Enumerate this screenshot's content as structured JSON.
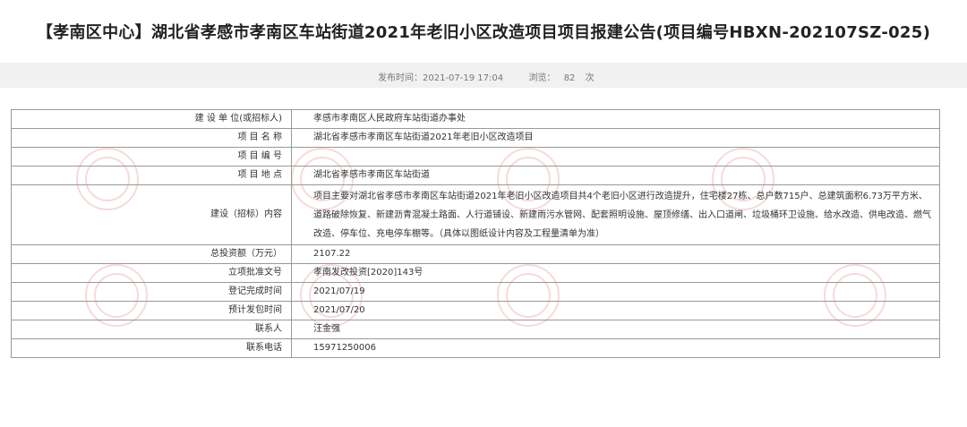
{
  "header": {
    "title": "【孝南区中心】湖北省孝感市孝南区车站街道2021年老旧小区改造项目项目报建公告(项目编号HBXN-202107SZ-025)",
    "publish_label": "发布时间：",
    "publish_time": "2021-07-19 17:04",
    "views_label": "浏览：",
    "views_count": "82",
    "views_unit": "次"
  },
  "rows": [
    {
      "label": "建 设 单 位(或招标人)",
      "value": "孝感市孝南区人民政府车站街道办事处"
    },
    {
      "label": "项 目 名 称",
      "value": "湖北省孝感市孝南区车站街道2021年老旧小区改造项目"
    },
    {
      "label": "项 目 编 号",
      "value": ""
    },
    {
      "label": "项 目 地 点",
      "value": "湖北省孝感市孝南区车站街道"
    },
    {
      "label": "建设（招标）内容",
      "value": "项目主要对湖北省孝感市孝南区车站街道2021年老旧小区改造项目共4个老旧小区进行改造提升，住宅楼27栋、总户数715户、总建筑面积6.73万平方米、道路破除恢复、新建沥青混凝土路面、人行道铺设、新建雨污水管网、配套照明设施、屋顶修缮、出入口道闸、垃圾桶环卫设施、给水改造、供电改造、燃气改造、停车位、充电停车棚等。（具体以图纸设计内容及工程量清单为准）"
    },
    {
      "label": "总投资额（万元）",
      "value": "2107.22"
    },
    {
      "label": "立项批准文号",
      "value": "孝南发改投资[2020]143号"
    },
    {
      "label": "登记完成时间",
      "value": "2021/07/19"
    },
    {
      "label": "预计发包时间",
      "value": "2021/07/20"
    },
    {
      "label": "联系人",
      "value": "汪金强"
    },
    {
      "label": "联系电话",
      "value": "15971250006"
    }
  ],
  "colors": {
    "watermark": "#f6d7d7",
    "border": "#999999",
    "meta_bg": "#f1f1f1"
  }
}
